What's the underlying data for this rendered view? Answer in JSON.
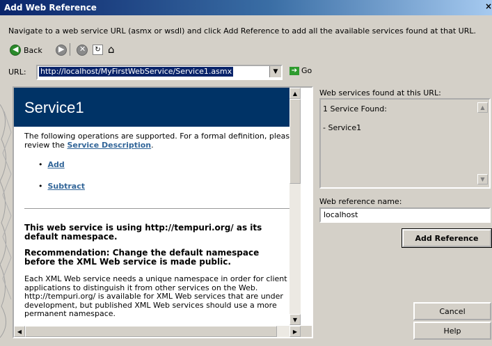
{
  "window": {
    "title": "Add Web Reference",
    "close_glyph": "×"
  },
  "instruction": "Navigate to a web service URL (asmx or wsdl) and click Add Reference to add all the available services found at that URL.",
  "toolbar": {
    "back_label": "Back"
  },
  "url": {
    "label": "URL:",
    "value": "http://localhost/MyFirstWebService/Service1.asmx",
    "go_label": "Go"
  },
  "browser": {
    "service_title": "Service1",
    "intro_text": "The following operations are supported. For a formal definition, please review the",
    "service_description_link": "Service Description",
    "intro_end": ".",
    "operations": [
      "Add",
      "Subtract"
    ],
    "namespace_heading": "This web service is using http://tempuri.org/ as its default namespace.",
    "recommendation_heading": "Recommendation: Change the default namespace before the XML Web service is made public.",
    "body_text": "Each XML Web service needs a unique namespace in order for client applications to distinguish it from other services on the Web. http://tempuri.org/ is available for XML Web services that are under development, but published XML Web services should use a more permanent namespace."
  },
  "found": {
    "label": "Web services found at this URL:",
    "count_text": "1 Service Found:",
    "service_item": "- Service1"
  },
  "reference": {
    "label": "Web reference name:",
    "value": "localhost"
  },
  "buttons": {
    "add_reference": "Add Reference",
    "cancel": "Cancel",
    "help": "Help"
  },
  "colors": {
    "title_bar": "#0a246a",
    "service_header": "#003366",
    "link": "#336699",
    "dialog_bg": "#d4d0c8"
  }
}
